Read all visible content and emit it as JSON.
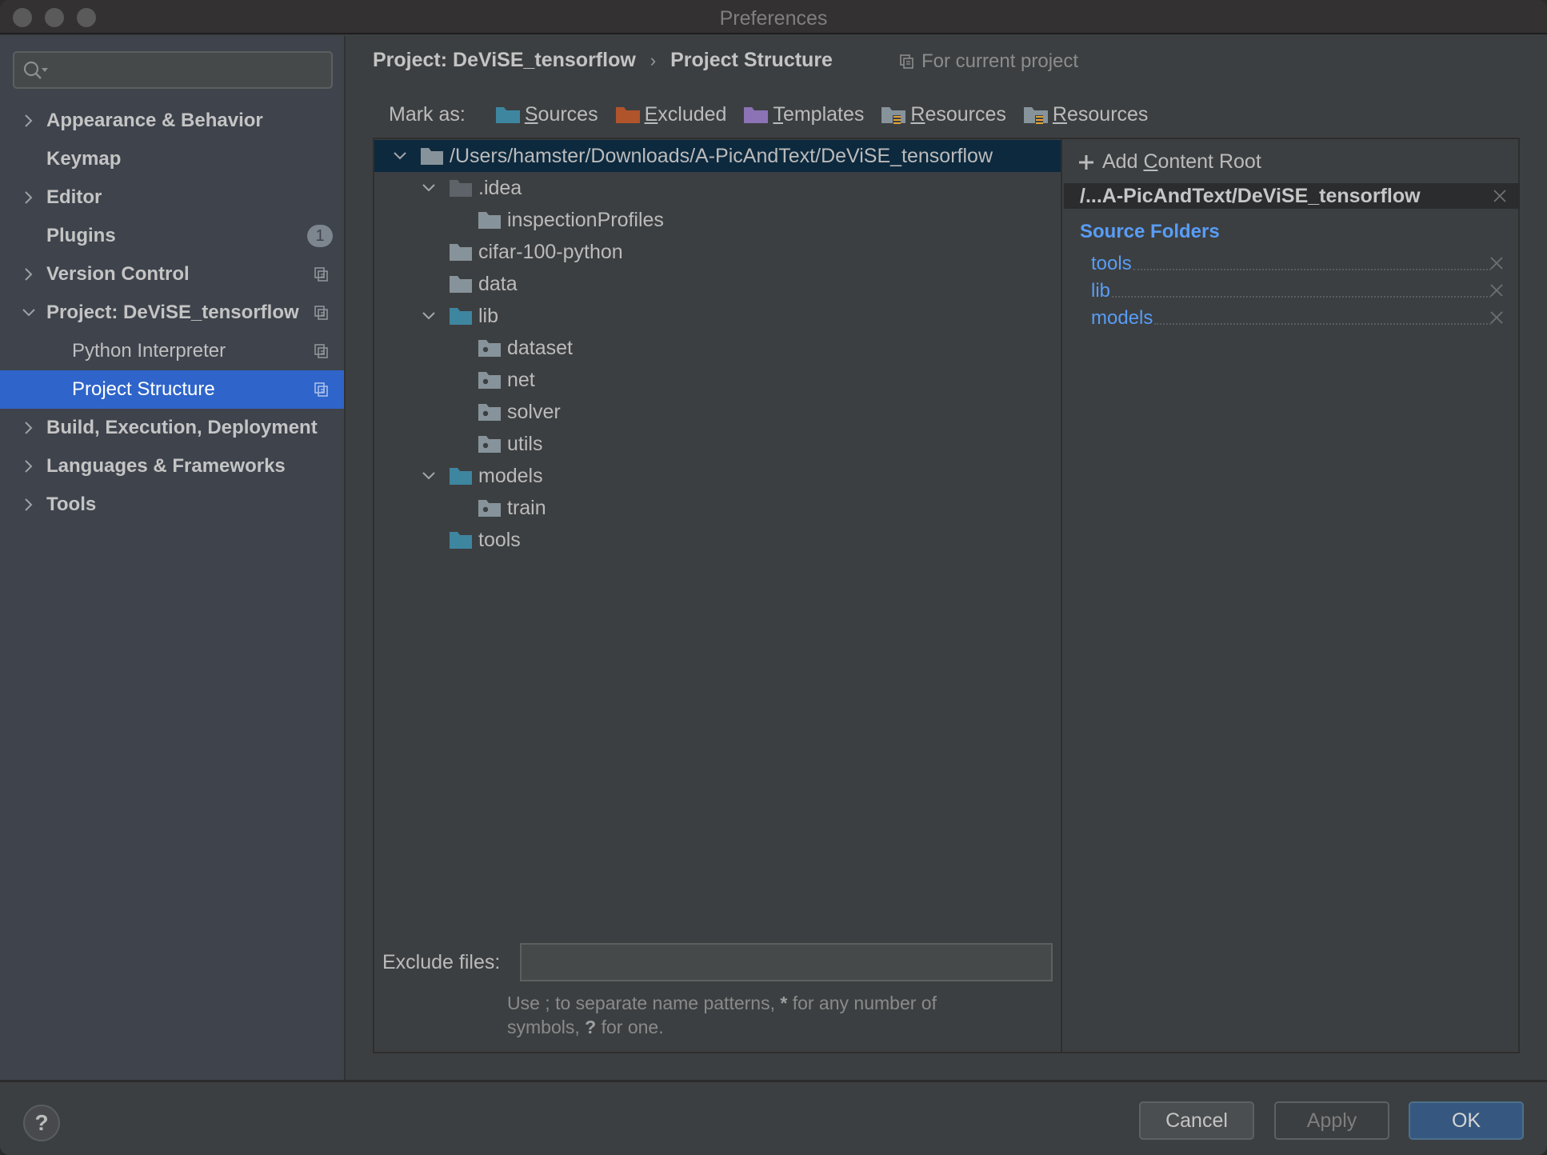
{
  "window": {
    "title": "Preferences"
  },
  "sidebar": {
    "search": {
      "value": "",
      "placeholder": ""
    },
    "items": [
      {
        "label": "Appearance & Behavior",
        "expandable": true,
        "expanded": false,
        "level": 0
      },
      {
        "label": "Keymap",
        "expandable": false,
        "level": 0
      },
      {
        "label": "Editor",
        "expandable": true,
        "expanded": false,
        "level": 0
      },
      {
        "label": "Plugins",
        "expandable": false,
        "level": 0,
        "badge": "1"
      },
      {
        "label": "Version Control",
        "expandable": true,
        "expanded": false,
        "level": 0,
        "project_scoped": true
      },
      {
        "label": "Project: DeViSE_tensorflow",
        "expandable": true,
        "expanded": true,
        "level": 0,
        "project_scoped": true
      },
      {
        "label": "Python Interpreter",
        "level": 1,
        "project_scoped": true
      },
      {
        "label": "Project Structure",
        "level": 1,
        "project_scoped": true,
        "selected": true
      },
      {
        "label": "Build, Execution, Deployment",
        "expandable": true,
        "expanded": false,
        "level": 0
      },
      {
        "label": "Languages & Frameworks",
        "expandable": true,
        "expanded": false,
        "level": 0
      },
      {
        "label": "Tools",
        "expandable": true,
        "expanded": false,
        "level": 0
      }
    ]
  },
  "header": {
    "breadcrumb": [
      "Project: DeViSE_tensorflow",
      "Project Structure"
    ],
    "breadcrumb_separator": "›",
    "scope_note": "For current project"
  },
  "mark_as": {
    "label": "Mark as:",
    "buttons": [
      {
        "mnemonic": "S",
        "rest": "ources",
        "label": "Sources",
        "color": "#3e86a0",
        "icon": "sources-folder-icon"
      },
      {
        "mnemonic": "E",
        "rest": "xcluded",
        "label": "Excluded",
        "color": "#b0542c",
        "icon": "excluded-folder-icon"
      },
      {
        "mnemonic": "T",
        "rest": "emplates",
        "label": "Templates",
        "color": "#8b73b5",
        "icon": "templates-folder-icon"
      },
      {
        "mnemonic": "R",
        "rest": "esources",
        "label": "Resources",
        "color": "#87939a",
        "icon": "resources-folder-icon"
      },
      {
        "mnemonic": "R",
        "rest": "esources",
        "label": "Resources",
        "color": "#87939a",
        "icon": "test-resources-folder-icon"
      }
    ]
  },
  "tree": {
    "rows": [
      {
        "name": "/Users/hamster/Downloads/A-PicAndText/DeViSE_tensorflow",
        "depth": 0,
        "expanded": true,
        "type": "root"
      },
      {
        "name": ".idea",
        "depth": 1,
        "expanded": true,
        "type": "dim"
      },
      {
        "name": "inspectionProfiles",
        "depth": 2,
        "type": "plain"
      },
      {
        "name": "cifar-100-python",
        "depth": 1,
        "type": "plain"
      },
      {
        "name": "data",
        "depth": 1,
        "type": "plain"
      },
      {
        "name": "lib",
        "depth": 1,
        "expanded": true,
        "type": "source"
      },
      {
        "name": "dataset",
        "depth": 2,
        "type": "package"
      },
      {
        "name": "net",
        "depth": 2,
        "type": "package"
      },
      {
        "name": "solver",
        "depth": 2,
        "type": "package"
      },
      {
        "name": "utils",
        "depth": 2,
        "type": "package"
      },
      {
        "name": "models",
        "depth": 1,
        "expanded": true,
        "type": "source"
      },
      {
        "name": "train",
        "depth": 2,
        "type": "package"
      },
      {
        "name": "tools",
        "depth": 1,
        "type": "source"
      }
    ]
  },
  "exclude_files": {
    "label": "Exclude files:",
    "value": "",
    "hint_parts": [
      "Use ; to separate name patterns, ",
      "*",
      " for any number of symbols, ",
      "?",
      " for one."
    ]
  },
  "content_roots": {
    "add_label_mnemonic": "C",
    "add_label_pre": "Add ",
    "add_label_post": "ontent Root",
    "root_path": "/...A-PicAndText/DeViSE_tensorflow",
    "source_folders_title": "Source Folders",
    "source_folders": [
      "tools",
      "lib",
      "models"
    ]
  },
  "footer": {
    "help": "?",
    "cancel": "Cancel",
    "apply": "Apply",
    "ok": "OK"
  },
  "colors": {
    "selection": "#2f65ca",
    "tree_root_selection": "#0d293e",
    "link_blue": "#589df6",
    "source_folder": "#3e86a0",
    "plain_folder": "#87939a",
    "ok_button": "#365880"
  }
}
